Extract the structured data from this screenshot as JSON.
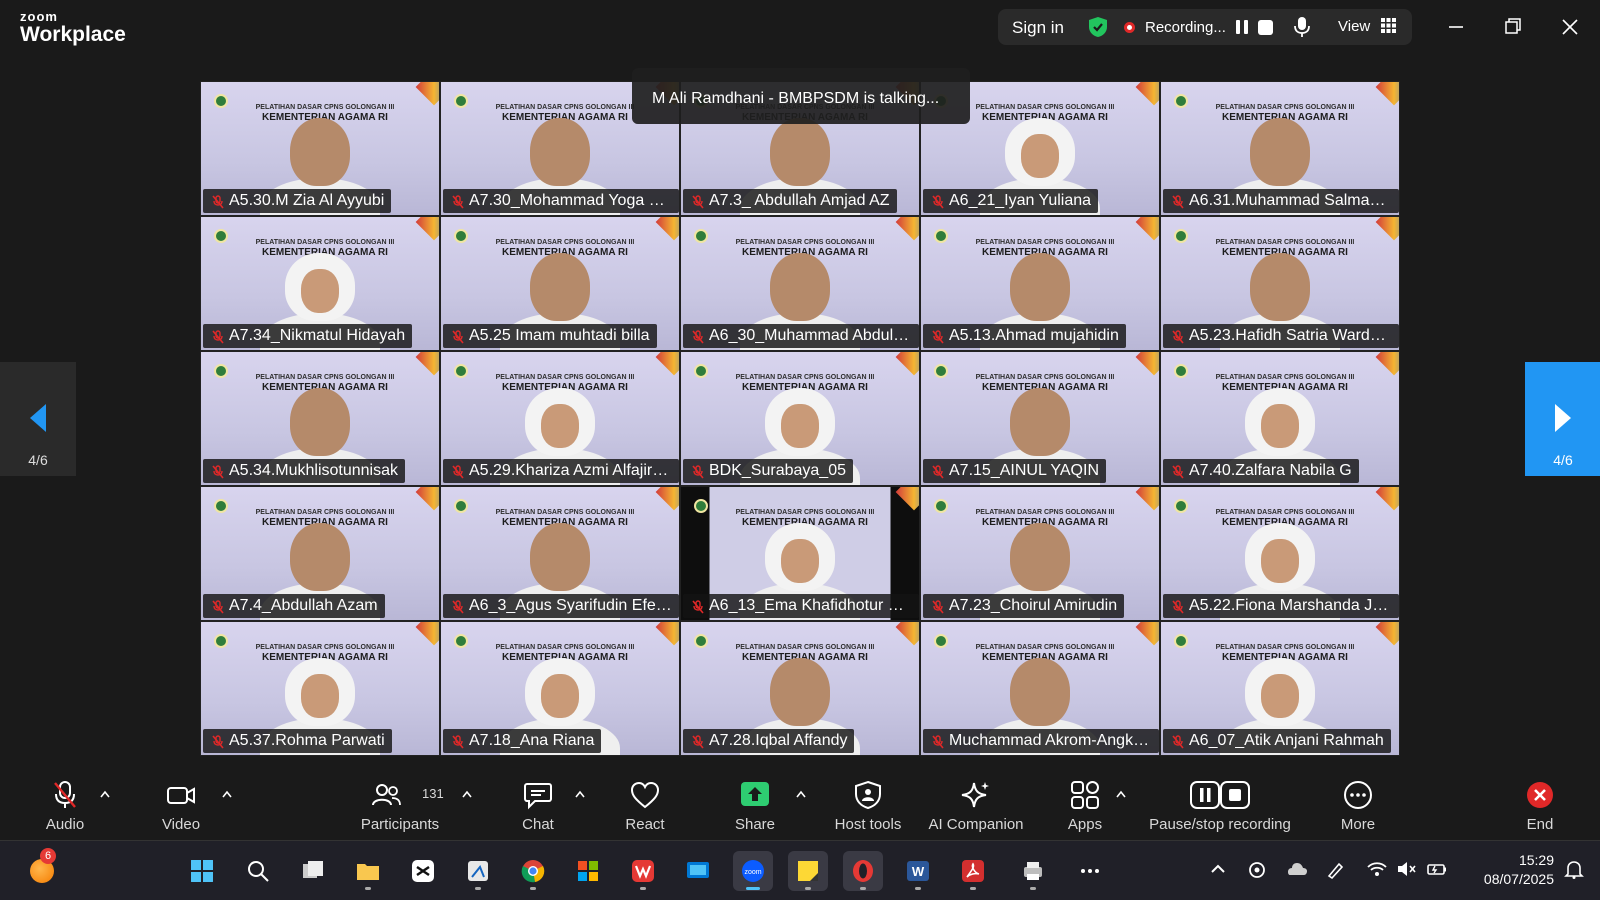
{
  "app": {
    "logo_top": "zoom",
    "logo_bottom": "Workplace"
  },
  "header": {
    "sign_in": "Sign in",
    "recording_label": "Recording...",
    "view_label": "View"
  },
  "talking_banner": "M Ali Ramdhani - BMBPSDM is talking...",
  "tile_banner": {
    "line1": "PELATIHAN DASAR CPNS GOLONGAN III",
    "line2": "KEMENTERIAN AGAMA RI"
  },
  "participants_grid": [
    {
      "name": "A5.30.M Zia Al Ayyubi",
      "style": "man"
    },
    {
      "name": "A7.30_Mohammad Yoga Pra...",
      "style": "man"
    },
    {
      "name": "A7.3_ Abdullah Amjad AZ",
      "style": "man"
    },
    {
      "name": "A6_21_Iyan Yuliana",
      "style": "hijab"
    },
    {
      "name": "A6.31.Muhammad Salman A...",
      "style": "man"
    },
    {
      "name": "A7.34_Nikmatul Hidayah",
      "style": "hijab"
    },
    {
      "name": "A5.25 Imam muhtadi billa",
      "style": "man"
    },
    {
      "name": "A6_30_Muhammad Abdul R...",
      "style": "man"
    },
    {
      "name": "A5.13.Ahmad mujahidin",
      "style": "man"
    },
    {
      "name": "A5.23.Hafidh Satria Wardanu",
      "style": "man"
    },
    {
      "name": "A5.34.Mukhlisotunnisak",
      "style": "man"
    },
    {
      "name": "A5.29.Khariza Azmi Alfajira ...",
      "style": "hijab"
    },
    {
      "name": "BDK_Surabaya_05",
      "style": "hijab"
    },
    {
      "name": "A7.15_AINUL YAQIN",
      "style": "man"
    },
    {
      "name": "A7.40.Zalfara Nabila G",
      "style": "hijab"
    },
    {
      "name": "A7.4_Abdullah Azam",
      "style": "man"
    },
    {
      "name": "A6_3_Agus Syarifudin Efendi",
      "style": "man"
    },
    {
      "name": "A6_13_Ema Khafidhotur Qur...",
      "style": "hijab-dark"
    },
    {
      "name": "A7.23_Choirul Amirudin",
      "style": "man"
    },
    {
      "name": "A5.22.Fiona Marshanda Julia...",
      "style": "hijab"
    },
    {
      "name": "A5.37.Rohma Parwati",
      "style": "hijab"
    },
    {
      "name": "A7.18_Ana Riana",
      "style": "hijab"
    },
    {
      "name": "A7.28.Iqbal Affandy",
      "style": "man"
    },
    {
      "name": "Muchammad Akrom-Angkat...",
      "style": "man"
    },
    {
      "name": "A6_07_Atik Anjani Rahmah",
      "style": "hijab"
    }
  ],
  "pagination": {
    "left_page": "4/6",
    "right_page": "4/6"
  },
  "toolbar": {
    "audio": "Audio",
    "video": "Video",
    "participants": "Participants",
    "participants_count": "131",
    "chat": "Chat",
    "react": "React",
    "share": "Share",
    "host_tools": "Host tools",
    "ai_companion": "AI Companion",
    "apps": "Apps",
    "pause_stop_recording": "Pause/stop recording",
    "more": "More",
    "end": "End"
  },
  "taskbar": {
    "notification_count": "6",
    "time": "15:29",
    "date": "08/07/2025"
  },
  "colors": {
    "share_green": "#2ecc71",
    "end_red": "#e02828",
    "pager_active": "#2196f3",
    "recording_red": "#e02828",
    "shield_green": "#22c55e"
  }
}
